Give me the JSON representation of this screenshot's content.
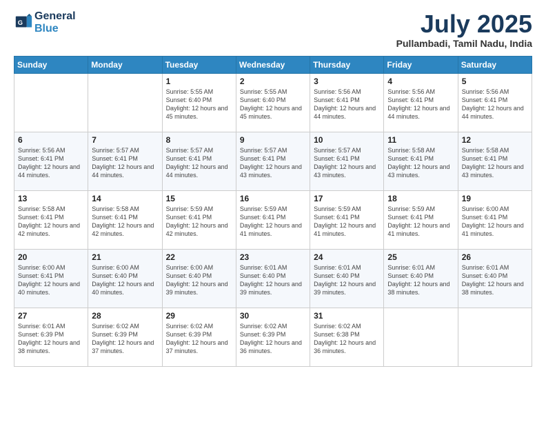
{
  "header": {
    "logo_line1": "General",
    "logo_line2": "Blue",
    "month": "July 2025",
    "location": "Pullambadi, Tamil Nadu, India"
  },
  "weekdays": [
    "Sunday",
    "Monday",
    "Tuesday",
    "Wednesday",
    "Thursday",
    "Friday",
    "Saturday"
  ],
  "weeks": [
    [
      {
        "day": "",
        "sunrise": "",
        "sunset": "",
        "daylight": ""
      },
      {
        "day": "",
        "sunrise": "",
        "sunset": "",
        "daylight": ""
      },
      {
        "day": "1",
        "sunrise": "Sunrise: 5:55 AM",
        "sunset": "Sunset: 6:40 PM",
        "daylight": "Daylight: 12 hours and 45 minutes."
      },
      {
        "day": "2",
        "sunrise": "Sunrise: 5:55 AM",
        "sunset": "Sunset: 6:40 PM",
        "daylight": "Daylight: 12 hours and 45 minutes."
      },
      {
        "day": "3",
        "sunrise": "Sunrise: 5:56 AM",
        "sunset": "Sunset: 6:41 PM",
        "daylight": "Daylight: 12 hours and 44 minutes."
      },
      {
        "day": "4",
        "sunrise": "Sunrise: 5:56 AM",
        "sunset": "Sunset: 6:41 PM",
        "daylight": "Daylight: 12 hours and 44 minutes."
      },
      {
        "day": "5",
        "sunrise": "Sunrise: 5:56 AM",
        "sunset": "Sunset: 6:41 PM",
        "daylight": "Daylight: 12 hours and 44 minutes."
      }
    ],
    [
      {
        "day": "6",
        "sunrise": "Sunrise: 5:56 AM",
        "sunset": "Sunset: 6:41 PM",
        "daylight": "Daylight: 12 hours and 44 minutes."
      },
      {
        "day": "7",
        "sunrise": "Sunrise: 5:57 AM",
        "sunset": "Sunset: 6:41 PM",
        "daylight": "Daylight: 12 hours and 44 minutes."
      },
      {
        "day": "8",
        "sunrise": "Sunrise: 5:57 AM",
        "sunset": "Sunset: 6:41 PM",
        "daylight": "Daylight: 12 hours and 44 minutes."
      },
      {
        "day": "9",
        "sunrise": "Sunrise: 5:57 AM",
        "sunset": "Sunset: 6:41 PM",
        "daylight": "Daylight: 12 hours and 43 minutes."
      },
      {
        "day": "10",
        "sunrise": "Sunrise: 5:57 AM",
        "sunset": "Sunset: 6:41 PM",
        "daylight": "Daylight: 12 hours and 43 minutes."
      },
      {
        "day": "11",
        "sunrise": "Sunrise: 5:58 AM",
        "sunset": "Sunset: 6:41 PM",
        "daylight": "Daylight: 12 hours and 43 minutes."
      },
      {
        "day": "12",
        "sunrise": "Sunrise: 5:58 AM",
        "sunset": "Sunset: 6:41 PM",
        "daylight": "Daylight: 12 hours and 43 minutes."
      }
    ],
    [
      {
        "day": "13",
        "sunrise": "Sunrise: 5:58 AM",
        "sunset": "Sunset: 6:41 PM",
        "daylight": "Daylight: 12 hours and 42 minutes."
      },
      {
        "day": "14",
        "sunrise": "Sunrise: 5:58 AM",
        "sunset": "Sunset: 6:41 PM",
        "daylight": "Daylight: 12 hours and 42 minutes."
      },
      {
        "day": "15",
        "sunrise": "Sunrise: 5:59 AM",
        "sunset": "Sunset: 6:41 PM",
        "daylight": "Daylight: 12 hours and 42 minutes."
      },
      {
        "day": "16",
        "sunrise": "Sunrise: 5:59 AM",
        "sunset": "Sunset: 6:41 PM",
        "daylight": "Daylight: 12 hours and 41 minutes."
      },
      {
        "day": "17",
        "sunrise": "Sunrise: 5:59 AM",
        "sunset": "Sunset: 6:41 PM",
        "daylight": "Daylight: 12 hours and 41 minutes."
      },
      {
        "day": "18",
        "sunrise": "Sunrise: 5:59 AM",
        "sunset": "Sunset: 6:41 PM",
        "daylight": "Daylight: 12 hours and 41 minutes."
      },
      {
        "day": "19",
        "sunrise": "Sunrise: 6:00 AM",
        "sunset": "Sunset: 6:41 PM",
        "daylight": "Daylight: 12 hours and 41 minutes."
      }
    ],
    [
      {
        "day": "20",
        "sunrise": "Sunrise: 6:00 AM",
        "sunset": "Sunset: 6:41 PM",
        "daylight": "Daylight: 12 hours and 40 minutes."
      },
      {
        "day": "21",
        "sunrise": "Sunrise: 6:00 AM",
        "sunset": "Sunset: 6:40 PM",
        "daylight": "Daylight: 12 hours and 40 minutes."
      },
      {
        "day": "22",
        "sunrise": "Sunrise: 6:00 AM",
        "sunset": "Sunset: 6:40 PM",
        "daylight": "Daylight: 12 hours and 39 minutes."
      },
      {
        "day": "23",
        "sunrise": "Sunrise: 6:01 AM",
        "sunset": "Sunset: 6:40 PM",
        "daylight": "Daylight: 12 hours and 39 minutes."
      },
      {
        "day": "24",
        "sunrise": "Sunrise: 6:01 AM",
        "sunset": "Sunset: 6:40 PM",
        "daylight": "Daylight: 12 hours and 39 minutes."
      },
      {
        "day": "25",
        "sunrise": "Sunrise: 6:01 AM",
        "sunset": "Sunset: 6:40 PM",
        "daylight": "Daylight: 12 hours and 38 minutes."
      },
      {
        "day": "26",
        "sunrise": "Sunrise: 6:01 AM",
        "sunset": "Sunset: 6:40 PM",
        "daylight": "Daylight: 12 hours and 38 minutes."
      }
    ],
    [
      {
        "day": "27",
        "sunrise": "Sunrise: 6:01 AM",
        "sunset": "Sunset: 6:39 PM",
        "daylight": "Daylight: 12 hours and 38 minutes."
      },
      {
        "day": "28",
        "sunrise": "Sunrise: 6:02 AM",
        "sunset": "Sunset: 6:39 PM",
        "daylight": "Daylight: 12 hours and 37 minutes."
      },
      {
        "day": "29",
        "sunrise": "Sunrise: 6:02 AM",
        "sunset": "Sunset: 6:39 PM",
        "daylight": "Daylight: 12 hours and 37 minutes."
      },
      {
        "day": "30",
        "sunrise": "Sunrise: 6:02 AM",
        "sunset": "Sunset: 6:39 PM",
        "daylight": "Daylight: 12 hours and 36 minutes."
      },
      {
        "day": "31",
        "sunrise": "Sunrise: 6:02 AM",
        "sunset": "Sunset: 6:38 PM",
        "daylight": "Daylight: 12 hours and 36 minutes."
      },
      {
        "day": "",
        "sunrise": "",
        "sunset": "",
        "daylight": ""
      },
      {
        "day": "",
        "sunrise": "",
        "sunset": "",
        "daylight": ""
      }
    ]
  ]
}
